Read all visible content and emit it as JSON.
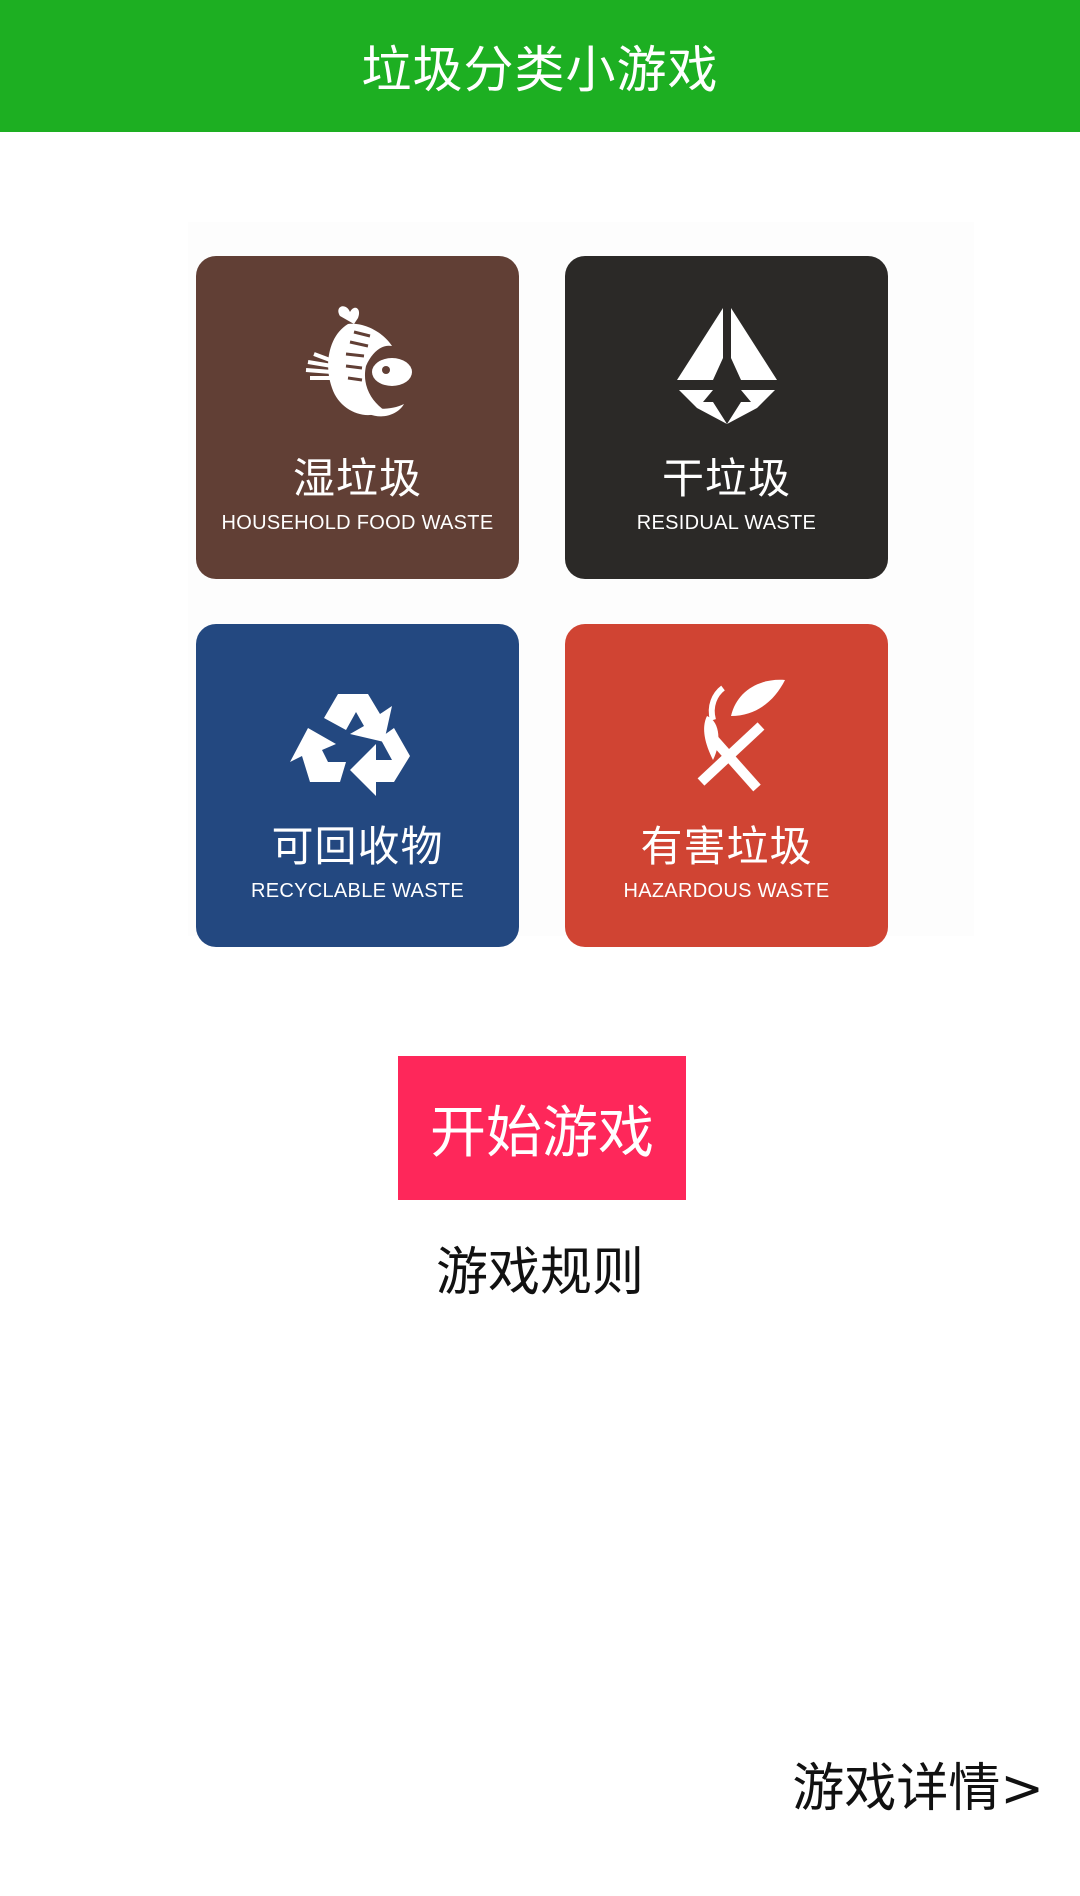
{
  "colors": {
    "header_bg": "#1daf22",
    "start_button_bg": "#fe275a",
    "wet_tile": "#613f35",
    "dry_tile": "#2b2927",
    "recycle_tile": "#234880",
    "hazard_tile": "#d04433"
  },
  "header": {
    "title": "垃圾分类小游戏"
  },
  "categories": [
    {
      "name_cn": "湿垃圾",
      "name_en": "HOUSEHOLD FOOD WASTE",
      "icon": "food-waste-icon"
    },
    {
      "name_cn": "干垃圾",
      "name_en": "RESIDUAL WASTE",
      "icon": "residual-waste-icon"
    },
    {
      "name_cn": "可回收物",
      "name_en": "RECYCLABLE WASTE",
      "icon": "recycle-icon"
    },
    {
      "name_cn": "有害垃圾",
      "name_en": "HAZARDOUS WASTE",
      "icon": "hazardous-icon"
    }
  ],
  "actions": {
    "start_label": "开始游戏",
    "rules_label": "游戏规则",
    "details_label": "游戏详情>"
  }
}
